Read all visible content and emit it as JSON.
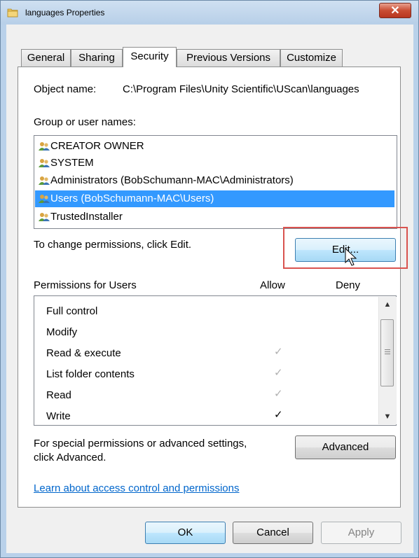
{
  "window": {
    "title": "languages Properties",
    "close_label": "✕"
  },
  "tabs": [
    "General",
    "Sharing",
    "Security",
    "Previous Versions",
    "Customize"
  ],
  "active_tab": "Security",
  "object_name": {
    "label": "Object name:",
    "value": "C:\\Program Files\\Unity Scientific\\UScan\\languages"
  },
  "groups": {
    "label": "Group or user names:",
    "items": [
      {
        "label": "CREATOR OWNER",
        "selected": false
      },
      {
        "label": "SYSTEM",
        "selected": false
      },
      {
        "label": "Administrators (BobSchumann-MAC\\Administrators)",
        "selected": false
      },
      {
        "label": "Users (BobSchumann-MAC\\Users)",
        "selected": true
      },
      {
        "label": "TrustedInstaller",
        "selected": false
      }
    ]
  },
  "change_text": "To change permissions, click Edit.",
  "edit_label": "Edit...",
  "permissions": {
    "label": "Permissions for Users",
    "allow_label": "Allow",
    "deny_label": "Deny",
    "rows": [
      {
        "name": "Full control",
        "allow": "",
        "deny": ""
      },
      {
        "name": "Modify",
        "allow": "",
        "deny": ""
      },
      {
        "name": "Read & execute",
        "allow": "✓",
        "deny": "",
        "allow_grayed": true
      },
      {
        "name": "List folder contents",
        "allow": "✓",
        "deny": "",
        "allow_grayed": true
      },
      {
        "name": "Read",
        "allow": "✓",
        "deny": "",
        "allow_grayed": true
      },
      {
        "name": "Write",
        "allow": "✓",
        "deny": "",
        "allow_grayed": false
      }
    ]
  },
  "special_text_line1": "For special permissions or advanced settings,",
  "special_text_line2": "click Advanced.",
  "advanced_label": "Advanced",
  "learn_link": "Learn about access control and permissions",
  "footer": {
    "ok": "OK",
    "cancel": "Cancel",
    "apply": "Apply"
  },
  "colors": {
    "selection": "#3399ff",
    "highlight": "#d9534f",
    "link": "#0066cc"
  }
}
